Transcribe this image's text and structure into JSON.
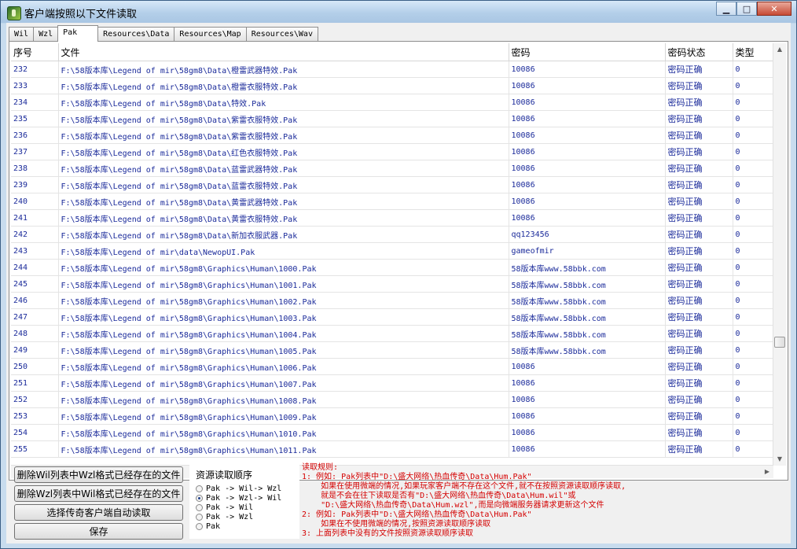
{
  "window": {
    "title": "客户端按照以下文件读取",
    "controls": {
      "minimize": "▁",
      "maximize": "□",
      "close": "✕"
    }
  },
  "tabs": [
    {
      "label": "Wil",
      "active": false
    },
    {
      "label": "Wzl",
      "active": false
    },
    {
      "label": "Pak",
      "active": true
    },
    {
      "label": "Resources\\Data",
      "active": false
    },
    {
      "label": "Resources\\Map",
      "active": false
    },
    {
      "label": "Resources\\Wav",
      "active": false
    }
  ],
  "table": {
    "columns": [
      "序号",
      "文件",
      "密码",
      "密码状态",
      "类型"
    ],
    "rows": [
      [
        "232",
        "F:\\58版本库\\Legend of mir\\58gm8\\Data\\橙雷武器特效.Pak",
        "10086",
        "密码正确",
        "0"
      ],
      [
        "233",
        "F:\\58版本库\\Legend of mir\\58gm8\\Data\\橙雷衣服特效.Pak",
        "10086",
        "密码正确",
        "0"
      ],
      [
        "234",
        "F:\\58版本库\\Legend of mir\\58gm8\\Data\\特效.Pak",
        "10086",
        "密码正确",
        "0"
      ],
      [
        "235",
        "F:\\58版本库\\Legend of mir\\58gm8\\Data\\紫雷衣服特效.Pak",
        "10086",
        "密码正确",
        "0"
      ],
      [
        "236",
        "F:\\58版本库\\Legend of mir\\58gm8\\Data\\紫雷衣服特效.Pak",
        "10086",
        "密码正确",
        "0"
      ],
      [
        "237",
        "F:\\58版本库\\Legend of mir\\58gm8\\Data\\红色衣服特效.Pak",
        "10086",
        "密码正确",
        "0"
      ],
      [
        "238",
        "F:\\58版本库\\Legend of mir\\58gm8\\Data\\蓝雷武器特效.Pak",
        "10086",
        "密码正确",
        "0"
      ],
      [
        "239",
        "F:\\58版本库\\Legend of mir\\58gm8\\Data\\蓝雷衣服特效.Pak",
        "10086",
        "密码正确",
        "0"
      ],
      [
        "240",
        "F:\\58版本库\\Legend of mir\\58gm8\\Data\\黄雷武器特效.Pak",
        "10086",
        "密码正确",
        "0"
      ],
      [
        "241",
        "F:\\58版本库\\Legend of mir\\58gm8\\Data\\黄雷衣服特效.Pak",
        "10086",
        "密码正确",
        "0"
      ],
      [
        "242",
        "F:\\58版本库\\Legend of mir\\58gm8\\Data\\新加衣服武器.Pak",
        "qq123456",
        "密码正确",
        "0"
      ],
      [
        "243",
        "F:\\58版本库\\Legend of mir\\data\\NewopUI.Pak",
        "gameofmir",
        "密码正确",
        "0"
      ],
      [
        "244",
        "F:\\58版本库\\Legend of mir\\58gm8\\Graphics\\Human\\1000.Pak",
        "58版本库www.58bbk.com",
        "密码正确",
        "0"
      ],
      [
        "245",
        "F:\\58版本库\\Legend of mir\\58gm8\\Graphics\\Human\\1001.Pak",
        "58版本库www.58bbk.com",
        "密码正确",
        "0"
      ],
      [
        "246",
        "F:\\58版本库\\Legend of mir\\58gm8\\Graphics\\Human\\1002.Pak",
        "58版本库www.58bbk.com",
        "密码正确",
        "0"
      ],
      [
        "247",
        "F:\\58版本库\\Legend of mir\\58gm8\\Graphics\\Human\\1003.Pak",
        "58版本库www.58bbk.com",
        "密码正确",
        "0"
      ],
      [
        "248",
        "F:\\58版本库\\Legend of mir\\58gm8\\Graphics\\Human\\1004.Pak",
        "58版本库www.58bbk.com",
        "密码正确",
        "0"
      ],
      [
        "249",
        "F:\\58版本库\\Legend of mir\\58gm8\\Graphics\\Human\\1005.Pak",
        "58版本库www.58bbk.com",
        "密码正确",
        "0"
      ],
      [
        "250",
        "F:\\58版本库\\Legend of mir\\58gm8\\Graphics\\Human\\1006.Pak",
        "10086",
        "密码正确",
        "0"
      ],
      [
        "251",
        "F:\\58版本库\\Legend of mir\\58gm8\\Graphics\\Human\\1007.Pak",
        "10086",
        "密码正确",
        "0"
      ],
      [
        "252",
        "F:\\58版本库\\Legend of mir\\58gm8\\Graphics\\Human\\1008.Pak",
        "10086",
        "密码正确",
        "0"
      ],
      [
        "253",
        "F:\\58版本库\\Legend of mir\\58gm8\\Graphics\\Human\\1009.Pak",
        "10086",
        "密码正确",
        "0"
      ],
      [
        "254",
        "F:\\58版本库\\Legend of mir\\58gm8\\Graphics\\Human\\1010.Pak",
        "10086",
        "密码正确",
        "0"
      ],
      [
        "255",
        "F:\\58版本库\\Legend of mir\\58gm8\\Graphics\\Human\\1011.Pak",
        "10086",
        "密码正确",
        "0"
      ]
    ]
  },
  "buttons": {
    "delete_wil": "删除Wil列表中Wzl格式已经存在的文件",
    "delete_wzl": "删除Wzl列表中Wil格式已经存在的文件",
    "auto_read": "选择传奇客户端自动读取",
    "save": "保存"
  },
  "read_order": {
    "title": "资源读取顺序",
    "options": [
      {
        "label": "Pak -> Wil-> Wzl",
        "selected": false
      },
      {
        "label": "Pak -> Wzl-> Wil",
        "selected": true
      },
      {
        "label": "Pak -> Wil",
        "selected": false
      },
      {
        "label": "Pak -> Wzl",
        "selected": false
      },
      {
        "label": "Pak",
        "selected": false
      }
    ]
  },
  "rules": {
    "lines": [
      "读取规则:",
      "1: 例如: Pak列表中\"D:\\盛大网络\\热血传奇\\Data\\Hum.Pak\"",
      "    如果在使用微端的情况,如果玩家客户端不存在这个文件,就不在按照资源读取顺序读取,",
      "    就是不会在往下读取是否有\"D:\\盛大网络\\热血传奇\\Data\\Hum.wil\"或",
      "    \"D:\\盛大网络\\热血传奇\\Data\\Hum.wzl\",而是向微端服务器请求更新这个文件",
      "2: 例如: Pak列表中\"D:\\盛大网络\\热血传奇\\Data\\Hum.Pak\"",
      "    如果在不使用微端的情况,按照资源读取顺序读取",
      "3: 上面列表中没有的文件按照资源读取顺序读取"
    ]
  },
  "colors": {
    "text_blue": "#1a2a9a",
    "rules_red": "#d40000",
    "client_bg": "#f0f0f0"
  }
}
